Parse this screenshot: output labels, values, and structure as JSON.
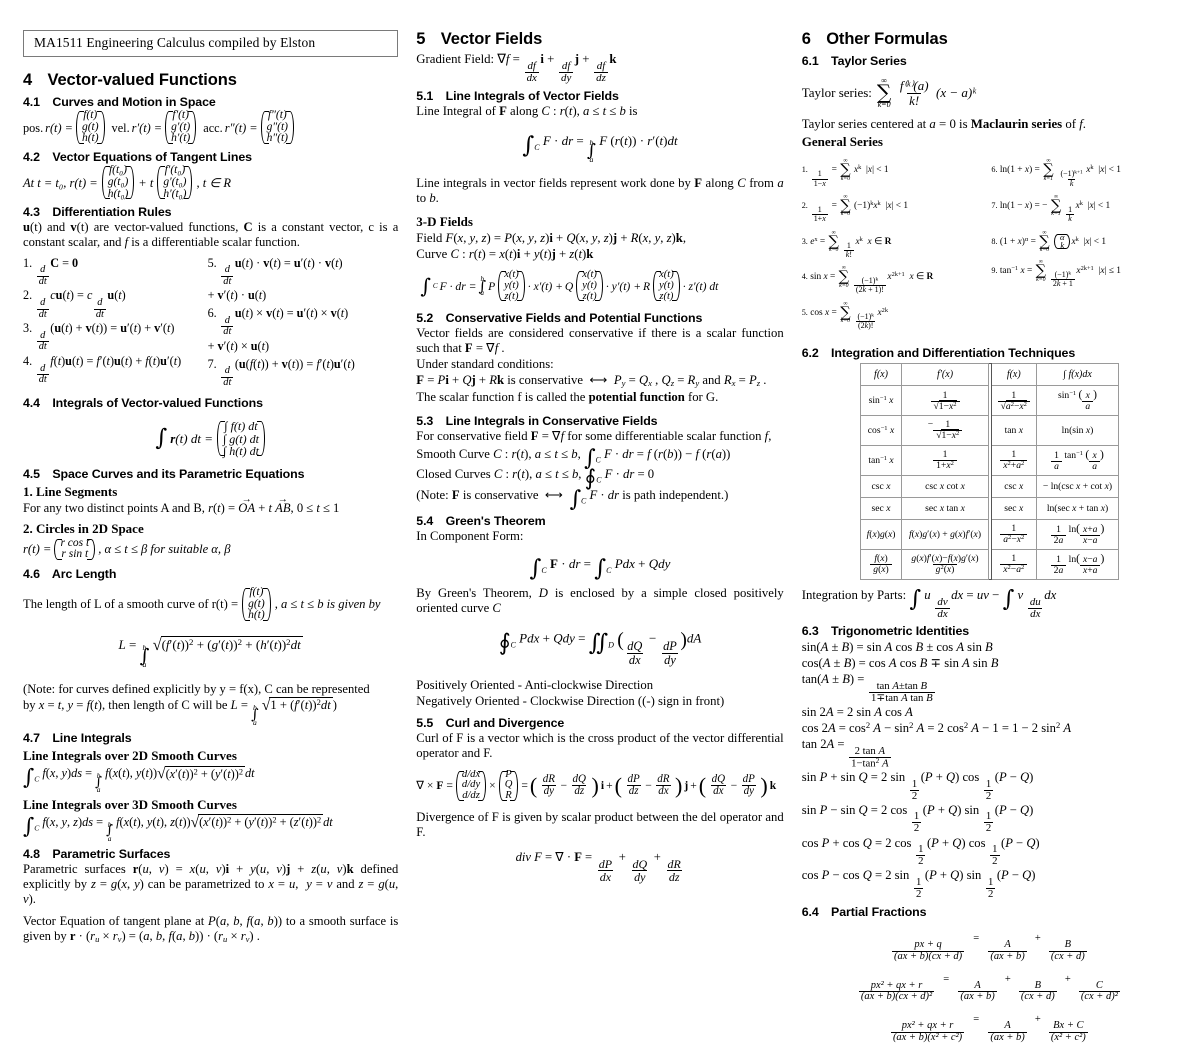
{
  "document": {
    "header_box": "MA1511 Engineering Calculus compiled by Elston"
  },
  "col1": {
    "s4": {
      "num": "4",
      "title": "Vector-valued Functions"
    },
    "s41": {
      "num": "4.1",
      "title": "Curves and Motion in Space",
      "pos_label": "pos.",
      "pos_lhs": "r(t) =",
      "pos_v": [
        "f(t)",
        "g(t)",
        "h(t)"
      ],
      "vel_label": "vel.",
      "vel_lhs": "r′(t) =",
      "vel_v": [
        "f′(t)",
        "g′(t)",
        "h′(t)"
      ],
      "acc_label": "acc.",
      "acc_lhs": "r″(t) =",
      "acc_v": [
        "f″(t)",
        "g″(t)",
        "h″(t)"
      ]
    },
    "s42": {
      "num": "4.2",
      "title": "Vector Equations of Tangent Lines",
      "lead": "At t = t₀, r(t) =",
      "v1": [
        "f(t₀)",
        "g(t₀)",
        "h(t₀)"
      ],
      "mid": "+ t",
      "v2": [
        "f′(t₀)",
        "g′(t₀)",
        "h′(t₀)"
      ],
      "tail": ", t ∈ R"
    },
    "s43": {
      "num": "4.3",
      "title": "Differentiation Rules",
      "intro": "u(t) and v(t) are vector-valued functions, C is a constant vector, c is a constant scalar, and f is a differentiable scalar function.",
      "left_rules": [
        "1. d/dt C = 0",
        "2. d/dt cu(t) = c d/dt u(t)",
        "3. d/dt (u(t) + v(t)) = u′(t) + v′(t)",
        "4. d/dt f(t)u(t) = f′(t)u(t) + f(t)u′(t)"
      ],
      "right_rules": [
        "5. d/dt u(t) · v(t) = u′(t) · v(t) + v′(t) · u(t)",
        "6. d/dt u(t) × v(t) = u′(t) × v(t) + v′(t) × u(t)",
        "7. d/dt (u(f(t)) + v(t)) = f′(t)u′(t)"
      ]
    },
    "s44": {
      "num": "4.4",
      "title": "Integrals of Vector-valued Functions",
      "lhs": "∫ r(t) dt =",
      "v": [
        "∫ f(t) dt",
        "∫ g(t) dt",
        "∫ h(t) dt"
      ]
    },
    "s45": {
      "num": "4.5",
      "title": "Space Curves and its Parametric Equations",
      "h1": "1. Line Segments",
      "l1": "For any two distinct points A and B, r(t) = OA + t AB, 0 ≤ t ≤ 1",
      "h2": "2. Circles in 2D Space",
      "l2_lhs": "r(t) =",
      "l2_v": [
        "r cos t",
        "r sin t"
      ],
      "l2_tail": ", α ≤ t ≤ β for suitable α, β"
    },
    "s46": {
      "num": "4.6",
      "title": "Arc Length",
      "lead": "The length of L of a smooth curve of r(t) =",
      "v": [
        "f(t)",
        "g(t)",
        "h(t)"
      ],
      "tail": ", a ≤ t ≤ b is given by",
      "formula": "L = ∫ₐᵇ √((f′(t))² + (g′(t))² + (h′(t))²) dt",
      "note1": "(Note: for curves defined explicitly by y = f(x), C can be represented",
      "note2": "by x = t, y = f(t), then length of C will be L = ∫ₐᵇ √(1 + (f′(t))²) dt)"
    },
    "s47": {
      "num": "4.7",
      "title": "Line Integrals",
      "h2d": "Line Integrals over 2D Smooth Curves",
      "f2d": "∫_C f(x,y)ds = ∫ₐᵇ f(x(t), y(t))√((x′(t))² + (y′(t))²) dt",
      "h3d": "Line Integrals over 3D Smooth Curves",
      "f3d": "∫_C f(x,y,z)ds = ∫ₐᵇ f(x(t), y(t), z(t))√((x′(t))² + (y′(t))² + (z′(t))²) dt"
    },
    "s48": {
      "num": "4.8",
      "title": "Parametric Surfaces",
      "p1": "Parametric surfaces r(u, v) = x(u, v)i + y(u, v)j + z(u, v)k defined explicitly by z = g(x, y) can be parametrized to x = u, y = v and z = g(u, v).",
      "p2": "Vector Equation of tangent plane at P(a, b, f(a, b)) to a smooth surface is given by r · (rᵤ × rᵥ) = (a, b, f(a, b)) · (rᵤ × rᵥ) ."
    }
  },
  "col2": {
    "s5": {
      "num": "5",
      "title": "Vector Fields",
      "gradient": "Gradient Field: ∇f = df/dx i + df/dy j + df/dz k"
    },
    "s51": {
      "num": "5.1",
      "title": "Line Integrals of Vector Fields",
      "lead": "Line Integral of F along C : r(t), a ≤ t ≤ b is",
      "formula": "∫_C F · dr = ∫ₐᵇ F(r(t)) · r′(t) dt",
      "note": "Line integrals in vector fields represent work done by F along C from a to b."
    },
    "fields3d": {
      "title": "3-D Fields",
      "l1": "Field F(x, y, z) = P(x, y, z)i + Q(x, y, z)j + R(x, y, z)k,",
      "l2": "Curve C : r(t) = x(t)i + y(t)j + z(t)k",
      "formula_lhs": "∫_C F · dr = ∫ₐᵇ",
      "p_label": "P",
      "q_label": "Q",
      "r_label": "R",
      "vec": [
        "x(t)",
        "y(t)",
        "z(t)"
      ],
      "p_tail": "· x′(t) +",
      "q_tail": "· y′(t) +",
      "r_tail": "· z′(t) dt"
    },
    "s52": {
      "num": "5.2",
      "title": "Conservative Fields and Potential Functions",
      "l1": "Vector fields are considered conservative if there is a scalar function such that F = ∇f .",
      "l2": "Under standard conditions:",
      "l3": "F = Pi + Qj + Rk is conservative ⟺ Pᵧ = Qₓ , Q_z = Rᵧ and Rₓ = P_z .",
      "l4a": "The scalar function f is called the ",
      "l4b": "potential function",
      "l4c": " for G."
    },
    "s53": {
      "num": "5.3",
      "title": "Line Integrals in Conservative Fields",
      "l1": "For conservative field F = ∇f for some differentiable scalar function f,",
      "l2": "Smooth Curve C : r(t), a ≤ t ≤ b, ∫_C F · dr = f(r(b)) − f(r(a))",
      "l3": "Closed Curves C : r(t), a ≤ t ≤ b, ∮_C F · dr = 0",
      "l4": "(Note: F is conservative ⟺ ∫_C F · dr is path independent.)"
    },
    "s54": {
      "num": "5.4",
      "title": "Green's Theorem",
      "l1": "In Component Form:",
      "f1": "∫_C F · dr = ∫_C Pdx + Qdy",
      "l2": "By Green's Theorem, D is enclosed by a simple closed positively oriented curve C",
      "f2": "∮_C Pdx + Qdy = ∬_D (dQ/dx − dP/dy) dA",
      "l3": "Positively Oriented - Anti-clockwise Direction",
      "l4": "Negatively Oriented - Clockwise Direction ((-) sign in front)"
    },
    "s55": {
      "num": "5.5",
      "title": "Curl and Divergence",
      "l1": "Curl of F is a vector which is the cross product of the vector differential operator and F.",
      "curl_lhs": "∇ × F =",
      "curl_v1": [
        "d/dx",
        "d/dy",
        "d/dz"
      ],
      "curl_v2": [
        "P",
        "Q",
        "R"
      ],
      "curl_rhs": "= (dR/dy − dQ/dz)i + (dP/dz − dR/dx)j + (dQ/dx − dP/dy)k",
      "l2": "Divergence of F is given by scalar product between the del operator and F.",
      "div": "div F = ∇ · F = dP/dx + dQ/dy + dR/dz"
    }
  },
  "col3": {
    "s6": {
      "num": "6",
      "title": "Other Formulas"
    },
    "s61": {
      "num": "6.1",
      "title": "Taylor Series",
      "taylor_label": "Taylor series:",
      "taylor_sum_top": "∞",
      "taylor_sum_bot": "k=0",
      "taylor_num": "f⁽ᵏ⁾(a)",
      "taylor_den": "k!",
      "taylor_tail": "(x − a)ᵏ",
      "maclaurin": "Taylor series centered at a = 0 is Maclaurin series of f.",
      "general_series_heading": "General Series",
      "series_left": [
        {
          "n": "1.",
          "body": "1/(1−x) = Σ(k=0..∞) xᵏ  |x| < 1"
        },
        {
          "n": "2.",
          "body": "1/(1+x) = Σ(k=0..∞) (−1)ᵏxᵏ  |x| < 1"
        },
        {
          "n": "3.",
          "body": "eˣ = Σ(k=0..∞) (1/k!)xᵏ  x ∈ R"
        },
        {
          "n": "4.",
          "body": "sin x = Σ(k=0..∞) (−1)ᵏ/(2k+1)! x²ᵏ⁺¹  x ∈ R"
        },
        {
          "n": "5.",
          "body": "cos x = Σ(k=0..∞) (−1)ᵏ/(2k)! x²ᵏ"
        }
      ],
      "series_right": [
        {
          "n": "6.",
          "body": "ln(1 + x) = Σ(k=1..∞) (−1)ᵏ⁺¹/k xᵏ  |x| < 1"
        },
        {
          "n": "7.",
          "body": "ln(1 − x) = − Σ(k=1..∞) (1/k) xᵏ  |x| < 1"
        },
        {
          "n": "8.",
          "body": "(1 + x)ᵅ = Σ(k=0..∞) (ᵅ choose k) xᵏ  |x| < 1"
        },
        {
          "n": "9.",
          "body": "tan⁻¹ x = Σ(k=0..∞) (−1)ᵏ/(2k+1) x²ᵏ⁺¹  |x| ≤ 1"
        }
      ]
    },
    "s62": {
      "num": "6.2",
      "title": "Integration and Differentiation Techniques",
      "headers": [
        "f(x)",
        "f′(x)",
        "f(x)",
        "∫ f(x)dx"
      ],
      "rows": [
        {
          "d_f": "sin⁻¹ x",
          "d_fp_n": "1",
          "d_fp_d": "√(1−x²)",
          "d_sign": "",
          "i_f_n": "1",
          "i_f_d": "√(a²−x²)",
          "i_f_plain": "",
          "i_res": "sin⁻¹ (x/a)"
        },
        {
          "d_f": "cos⁻¹ x",
          "d_fp_n": "1",
          "d_fp_d": "√(1−x²)",
          "d_sign": "−",
          "i_f_plain": "tan x",
          "i_res": "ln(sin x)"
        },
        {
          "d_f": "tan⁻¹ x",
          "d_fp_n": "1",
          "d_fp_d": "1+x²",
          "d_sign": "",
          "i_f_n": "1",
          "i_f_d": "x²+a²",
          "i_f_plain": "",
          "i_res": "(1/a) tan⁻¹ (x/a)"
        },
        {
          "d_f": "csc x",
          "d_fp_plain": "csc x cot x",
          "i_f_plain": "csc x",
          "i_res": "− ln(csc x + cot x)"
        },
        {
          "d_f": "sec x",
          "d_fp_plain": "sec x tan x",
          "i_f_plain": "sec x",
          "i_res": "ln(sec x + tan x)"
        },
        {
          "d_f": "f(x)g(x)",
          "d_fp_plain": "f(x)g′(x) + g(x)f′(x)",
          "i_f_n": "1",
          "i_f_d": "a²−x²",
          "i_f_plain": "",
          "i_res": "(1/2a) ln((x+a)/(x−a))"
        },
        {
          "d_f_n": "f(x)",
          "d_f_d": "g(x)",
          "d_fp_n": "g(x)f′(x)−f(x)g′(x)",
          "d_fp_d": "g²(x)",
          "i_f_n": "1",
          "i_f_d": "x²−a²",
          "i_f_plain": "",
          "i_res": "(1/2a) ln((x−a)/(x+a))"
        }
      ],
      "by_parts": "Integration by Parts: ∫ u (dv/dx) dx = uv − ∫ v (du/dx) dx"
    },
    "s63": {
      "num": "6.3",
      "title": "Trigonometric Identities",
      "items": [
        "sin(A ± B) = sin A cos B ± cos A sin B",
        "cos(A ± B) = cos A cos B ∓ sin A sin B",
        "tan(A ± B) = (tan A ± tan B)/(1 ∓ tan A tan B)",
        "sin 2A = 2 sin A cos A",
        "cos 2A = cos² A − sin² A = 2cos² A − 1 = 1 − 2sin² A",
        "tan 2A = (2 tan A)/(1 − tan² A)",
        "sin P + sin Q = 2 sin ½(P + Q) cos ½(P − Q)",
        "sin P − sin Q = 2 cos ½(P + Q) sin ½(P − Q)",
        "cos P + cos Q = 2 cos ½(P + Q) cos ½(P − Q)",
        "cos P − cos Q = 2 sin ½(P + Q) sin ½(P − Q)"
      ]
    },
    "s64": {
      "num": "6.4",
      "title": "Partial Fractions",
      "rows": [
        {
          "lhs_n": "px + q",
          "lhs_d": "(ax + b)(cx + d)",
          "terms": [
            {
              "n": "A",
              "d": "(ax + b)"
            },
            {
              "n": "B",
              "d": "(cx + d)"
            }
          ]
        },
        {
          "lhs_n": "px² + qx + r",
          "lhs_d": "(ax + b)(cx + d)²",
          "terms": [
            {
              "n": "A",
              "d": "(ax + b)"
            },
            {
              "n": "B",
              "d": "(cx + d)"
            },
            {
              "n": "C",
              "d": "(cx + d)²"
            }
          ]
        },
        {
          "lhs_n": "px² + qx + r",
          "lhs_d": "(ax + b)(x² + c²)",
          "terms": [
            {
              "n": "A",
              "d": "(ax + b)"
            },
            {
              "n": "Bx + C",
              "d": "(x² + c²)"
            }
          ]
        }
      ]
    }
  }
}
